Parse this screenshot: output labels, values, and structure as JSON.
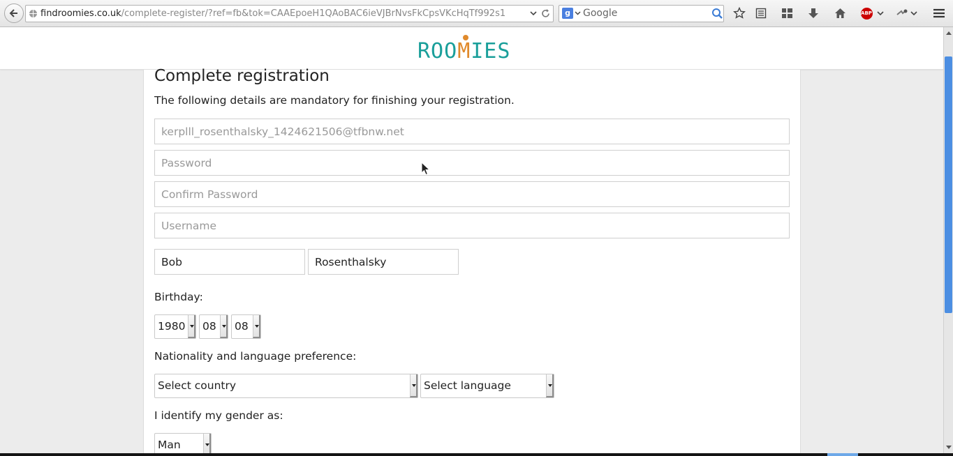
{
  "browser": {
    "url_host": "findroomies.co.uk",
    "url_path": "/complete-register/?ref=fb&tok=CAAEpoeH1QAoBAC6ieVJBrNvsFkCpsVKcHqTf992s1",
    "search_placeholder": "Google",
    "search_engine_letter": "g",
    "adblock_label": "ABP"
  },
  "site": {
    "logo_text_before": "ROO",
    "logo_m": "M",
    "logo_text_after": "IES",
    "brand_color": "#1a9f9a",
    "accent_color": "#e08a2c"
  },
  "form": {
    "title": "Complete registration",
    "subtitle": "The following details are mandatory for finishing your registration.",
    "email_placeholder": "kerplll_rosenthalsky_1424621506@tfbnw.net",
    "password_placeholder": "Password",
    "confirm_password_placeholder": "Confirm Password",
    "username_placeholder": "Username",
    "first_name": "Bob",
    "last_name": "Rosenthalsky",
    "birthday_label": "Birthday:",
    "birth_year": "1980",
    "birth_month": "08",
    "birth_day": "08",
    "nationality_label": "Nationality and language preference:",
    "country_select": "Select country",
    "language_select": "Select language",
    "gender_label": "I identify my gender as:",
    "gender_select": "Man"
  },
  "icons": {
    "back": "back-arrow-icon",
    "globe": "globe-icon",
    "reload": "reload-icon",
    "search": "magnifier-icon",
    "bookmark": "star-icon",
    "reading_list": "list-icon",
    "apps": "grid-icon",
    "download": "download-arrow-icon",
    "home": "home-icon",
    "menu": "hamburger-icon"
  }
}
